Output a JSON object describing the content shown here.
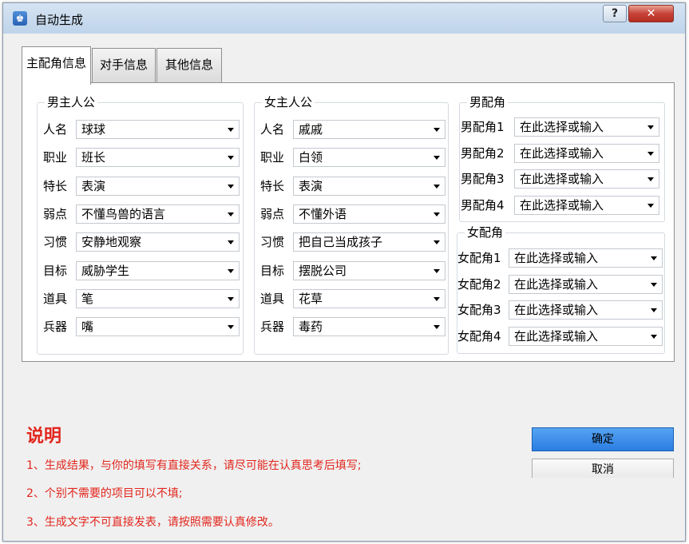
{
  "window": {
    "title": "自动生成",
    "help_label": "?",
    "close_label": "✕",
    "icon": "app-icon"
  },
  "tabs": [
    {
      "label": "主配角信息",
      "active": true
    },
    {
      "label": "对手信息",
      "active": false
    },
    {
      "label": "其他信息",
      "active": false
    }
  ],
  "male_lead": {
    "title": "男主人公",
    "fields": [
      {
        "label": "人名",
        "value": "球球"
      },
      {
        "label": "职业",
        "value": "班长"
      },
      {
        "label": "特长",
        "value": "表演"
      },
      {
        "label": "弱点",
        "value": "不懂鸟兽的语言"
      },
      {
        "label": "习惯",
        "value": "安静地观察"
      },
      {
        "label": "目标",
        "value": "威胁学生"
      },
      {
        "label": "道具",
        "value": "笔"
      },
      {
        "label": "兵器",
        "value": "嘴"
      }
    ]
  },
  "female_lead": {
    "title": "女主人公",
    "fields": [
      {
        "label": "人名",
        "value": "戚戚"
      },
      {
        "label": "职业",
        "value": "白领"
      },
      {
        "label": "特长",
        "value": "表演"
      },
      {
        "label": "弱点",
        "value": "不懂外语"
      },
      {
        "label": "习惯",
        "value": "把自己当成孩子"
      },
      {
        "label": "目标",
        "value": "摆脱公司"
      },
      {
        "label": "道具",
        "value": "花草"
      },
      {
        "label": "兵器",
        "value": "毒药"
      }
    ]
  },
  "male_support": {
    "title": "男配角",
    "fields": [
      {
        "label": "男配角1",
        "value": "在此选择或输入"
      },
      {
        "label": "男配角2",
        "value": "在此选择或输入"
      },
      {
        "label": "男配角3",
        "value": "在此选择或输入"
      },
      {
        "label": "男配角4",
        "value": "在此选择或输入"
      }
    ]
  },
  "female_support": {
    "title": "女配角",
    "fields": [
      {
        "label": "女配角1",
        "value": "在此选择或输入"
      },
      {
        "label": "女配角2",
        "value": "在此选择或输入"
      },
      {
        "label": "女配角3",
        "value": "在此选择或输入"
      },
      {
        "label": "女配角4",
        "value": "在此选择或输入"
      }
    ]
  },
  "notes": {
    "title": "说明",
    "items": [
      "1、生成结果，与你的填写有直接关系，请尽可能在认真思考后填写;",
      "2、个别不需要的项目可以不填;",
      "3、生成文字不可直接发表，请按照需要认真修改。"
    ]
  },
  "buttons": {
    "ok": "确定",
    "cancel": "取消"
  },
  "colors": {
    "note_red": "#e2261d",
    "primary_blue": "#2a7de2",
    "title_bar": "#c9dcef"
  }
}
